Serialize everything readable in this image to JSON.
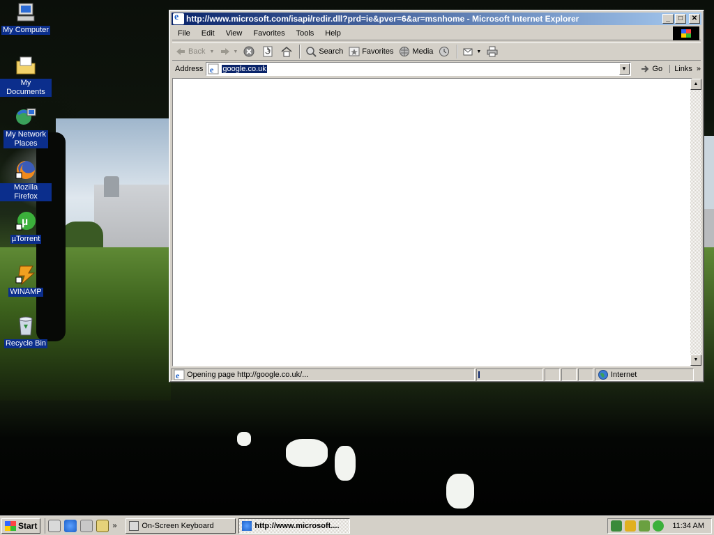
{
  "desktop": {
    "icons": [
      {
        "label": "My Computer",
        "icon": "my-computer-icon"
      },
      {
        "label": "My Documents",
        "icon": "my-documents-icon"
      },
      {
        "label": "My Network Places",
        "icon": "network-places-icon"
      },
      {
        "label": "Mozilla Firefox",
        "icon": "firefox-icon"
      },
      {
        "label": "µTorrent",
        "icon": "utorrent-icon"
      },
      {
        "label": "WINAMP",
        "icon": "winamp-icon"
      },
      {
        "label": "Recycle Bin",
        "icon": "recycle-bin-icon"
      }
    ]
  },
  "window": {
    "title": "http://www.microsoft.com/isapi/redir.dll?prd=ie&pver=6&ar=msnhome - Microsoft Internet Explorer",
    "controls": {
      "minimize": "_",
      "maximize": "□",
      "close": "✕"
    },
    "menu": [
      "File",
      "Edit",
      "View",
      "Favorites",
      "Tools",
      "Help"
    ],
    "toolbar": {
      "back": "Back",
      "search": "Search",
      "favorites": "Favorites",
      "media": "Media"
    },
    "address": {
      "label": "Address",
      "value": "google.co.uk",
      "go": "Go",
      "links": "Links"
    },
    "status": {
      "text": "Opening page http://google.co.uk/...",
      "zone": "Internet",
      "progress": 0.02
    }
  },
  "taskbar": {
    "start": "Start",
    "tasks": [
      {
        "label": "On-Screen Keyboard",
        "active": false
      },
      {
        "label": "http://www.microsoft....",
        "active": true
      }
    ],
    "clock": "11:34 AM"
  },
  "colors": {
    "titlebar_start": "#0a246a",
    "titlebar_end": "#a6caf0",
    "chrome": "#d4d0c8",
    "selection": "#0a246a"
  }
}
